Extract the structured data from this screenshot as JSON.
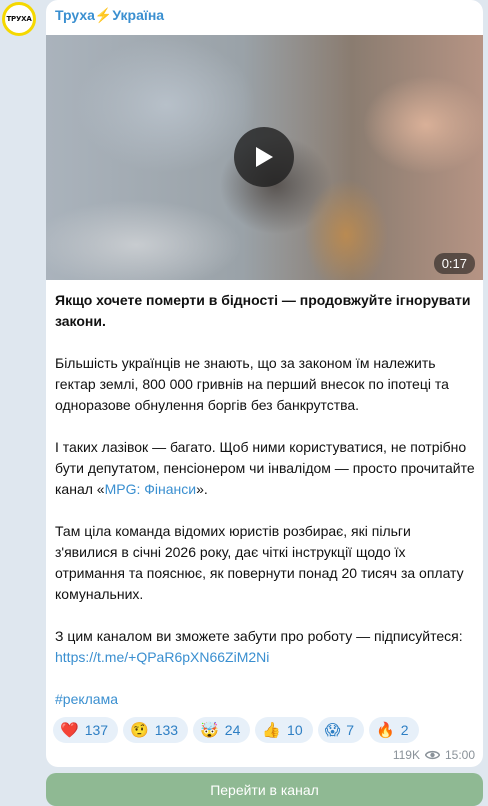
{
  "channel": {
    "avatar_text": "ТРУХА",
    "name_part1": "Труха",
    "bolt": "⚡",
    "name_part2": "Україна"
  },
  "video": {
    "duration": "0:17",
    "play_icon": "play-icon"
  },
  "post": {
    "headline": "Якщо хочете померти в бідності — продовжуйте ігнорувати закони.",
    "para1": "Більшість українців не знають, що за законом їм належить гектар землі, 800 000 гривнів на перший внесок по іпотеці та одноразове обнулення боргів без банкрутства.",
    "para2_before": "І таких лазівок — багато. Щоб ними користуватися, не потрібно бути депутатом, пенсіонером чи інвалідом — просто прочитайте канал «",
    "para2_link": "MPG: Фінанси",
    "para2_after": "».",
    "para3": "Там ціла команда відомих юристів розбирає, які пільги з'явилися в січні 2026 року, дає чіткі інструкції щодо їх отримання та пояснює, як повернути понад 20 тисяч за оплату комунальних.",
    "para4": "З цим каналом ви зможете забути про роботу — підписуйтеся:",
    "url": "https://t.me/+QPaR6pXN66ZiM2Ni",
    "hashtag": "#реклама"
  },
  "reactions": [
    {
      "emoji": "❤️",
      "count": "137",
      "name": "heart"
    },
    {
      "emoji": "🤨",
      "count": "133",
      "name": "raised-eyebrow"
    },
    {
      "emoji": "🤯",
      "count": "24",
      "name": "exploding-head"
    },
    {
      "emoji": "👍",
      "count": "10",
      "name": "thumbs-up"
    },
    {
      "emoji": "😱",
      "count": "7",
      "name": "screaming"
    },
    {
      "emoji": "🔥",
      "count": "2",
      "name": "fire"
    }
  ],
  "meta": {
    "views": "119K",
    "time": "15:00"
  },
  "cta": {
    "label": "Перейти в канал"
  },
  "colors": {
    "link": "#3a8fd0",
    "cta_bg": "#8fb993",
    "reaction_bg": "#e7f0f9",
    "avatar_ring": "#f5d800"
  }
}
